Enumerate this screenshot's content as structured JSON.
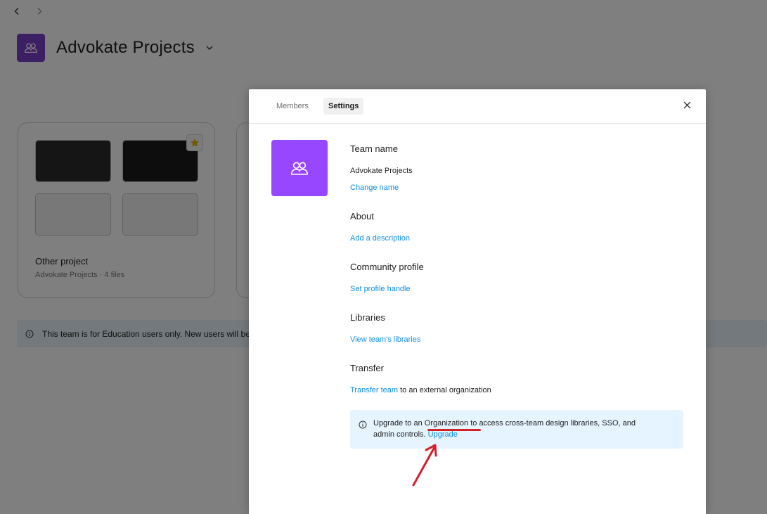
{
  "background": {
    "team_name": "Advokate Projects",
    "project_card": {
      "title": "Other project",
      "subtitle": "Advokate Projects · 4 files"
    },
    "banner_text": "This team is for Education users only. New users will be r"
  },
  "modal": {
    "tabs": {
      "members": "Members",
      "settings": "Settings"
    },
    "sections": {
      "team_name": {
        "title": "Team name",
        "value": "Advokate Projects",
        "link": "Change name"
      },
      "about": {
        "title": "About",
        "link": "Add a description"
      },
      "community": {
        "title": "Community profile",
        "link": "Set profile handle"
      },
      "libraries": {
        "title": "Libraries",
        "link": "View team's libraries"
      },
      "transfer": {
        "title": "Transfer",
        "link": "Transfer team",
        "suffix": " to an external organization"
      }
    },
    "upgrade_notice": {
      "prefix": "Upgrade to an ",
      "highlight": "Organization",
      "suffix": " to access cross-team design libraries, SSO, and",
      "line2": "admin controls. ",
      "link": "Upgrade"
    }
  },
  "colors": {
    "accent": "#9747ff",
    "link": "#0d8ee9",
    "annotation": "#d4202a"
  }
}
